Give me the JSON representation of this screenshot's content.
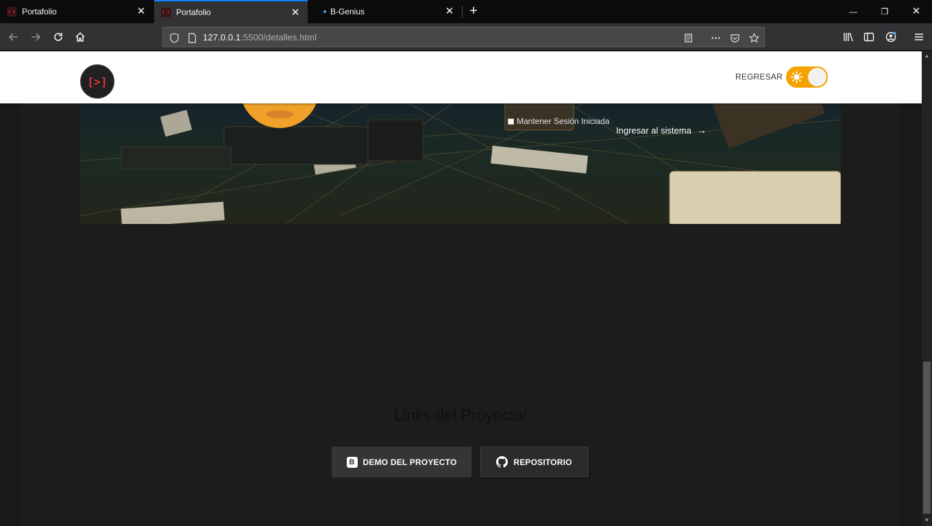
{
  "browser": {
    "tabs": [
      {
        "title": "Portafolio",
        "active": false
      },
      {
        "title": "Portafolio",
        "active": true
      },
      {
        "title": "B-Genius",
        "active": false
      }
    ],
    "url_host": "127.0.0.1",
    "url_rest": ":5500/detalles.html",
    "colors": {
      "active_tab_accent": "#0a84ff",
      "chrome_dark": "#0c0c0d",
      "toolbar": "#323234"
    }
  },
  "header": {
    "logo_text": "[>]",
    "back_label": "REGRESAR",
    "theme_toggle_on": true,
    "colors": {
      "toggle": "#f5a200",
      "logo_accent": "#e53340"
    }
  },
  "hero": {
    "keep_session_label": "Mantener Sesión Iniciada",
    "enter_label": "Ingresar al sistema",
    "enter_arrow": "→"
  },
  "links": {
    "title": "Links del Proyecto!",
    "demo_icon_letter": "B",
    "demo_label": "DEMO DEL PROYECTO",
    "repo_label": "REPOSITORIO",
    "icons": [
      "bootstrap-icon",
      "github-icon"
    ]
  }
}
